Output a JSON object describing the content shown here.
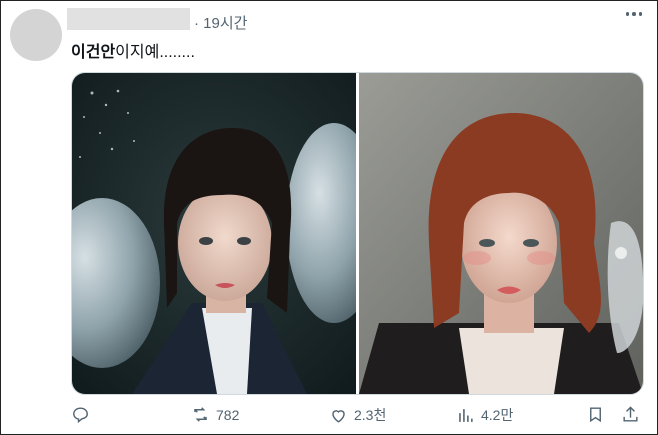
{
  "post": {
    "time": "· 19시간",
    "text_bold": "이건안",
    "text_rest": "이지예........"
  },
  "media": {
    "left_photo": "portrait-dark-bob-balloons",
    "right_photo": "portrait-red-bob-grey-wall"
  },
  "actions": {
    "reply_icon": "reply-icon",
    "retweet_count": "782",
    "like_count": "2.3천",
    "views_count": "4.2만"
  }
}
